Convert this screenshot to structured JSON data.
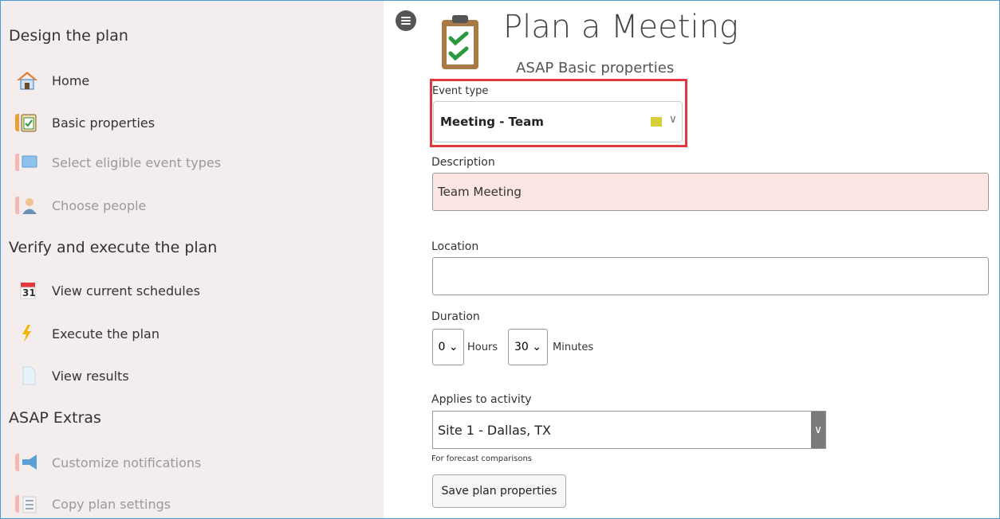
{
  "sidebar": {
    "sections": [
      {
        "title": "Design the plan"
      },
      {
        "title": "Verify and execute the plan"
      },
      {
        "title": "ASAP Extras"
      }
    ],
    "items": {
      "home": {
        "label": "Home",
        "icon": "home-icon"
      },
      "basic": {
        "label": "Basic properties",
        "icon": "clipboard-icon"
      },
      "eligible": {
        "label": "Select eligible event types",
        "icon": "monitor-icon"
      },
      "people": {
        "label": "Choose people",
        "icon": "person-icon"
      },
      "schedules": {
        "label": "View current schedules",
        "icon": "calendar-icon",
        "calendar_day": "31"
      },
      "execute": {
        "label": "Execute the plan",
        "icon": "lightning-icon"
      },
      "results": {
        "label": "View results",
        "icon": "document-icon"
      },
      "notifications": {
        "label": "Customize notifications",
        "icon": "megaphone-icon"
      },
      "copy": {
        "label": "Copy plan settings",
        "icon": "list-icon"
      }
    }
  },
  "header": {
    "title": "Plan a Meeting",
    "subtitle": "ASAP Basic properties"
  },
  "form": {
    "event_type": {
      "label": "Event type",
      "value": "Meeting - Team",
      "swatch_color": "#d6cf3a"
    },
    "description": {
      "label": "Description",
      "value": "Team Meeting"
    },
    "location": {
      "label": "Location",
      "value": ""
    },
    "duration": {
      "label": "Duration",
      "hours": "0",
      "hours_unit": "Hours",
      "minutes": "30",
      "minutes_unit": "Minutes"
    },
    "applies": {
      "label": "Applies to activity",
      "value": "Site 1 - Dallas, TX",
      "hint": "For forecast comparisons"
    },
    "save_label": "Save plan properties"
  },
  "colors": {
    "sidebar_bg": "#f3eded",
    "highlight": "#e0393e",
    "error_bg": "#fce5e3",
    "tab_active": "#e9a03b"
  }
}
